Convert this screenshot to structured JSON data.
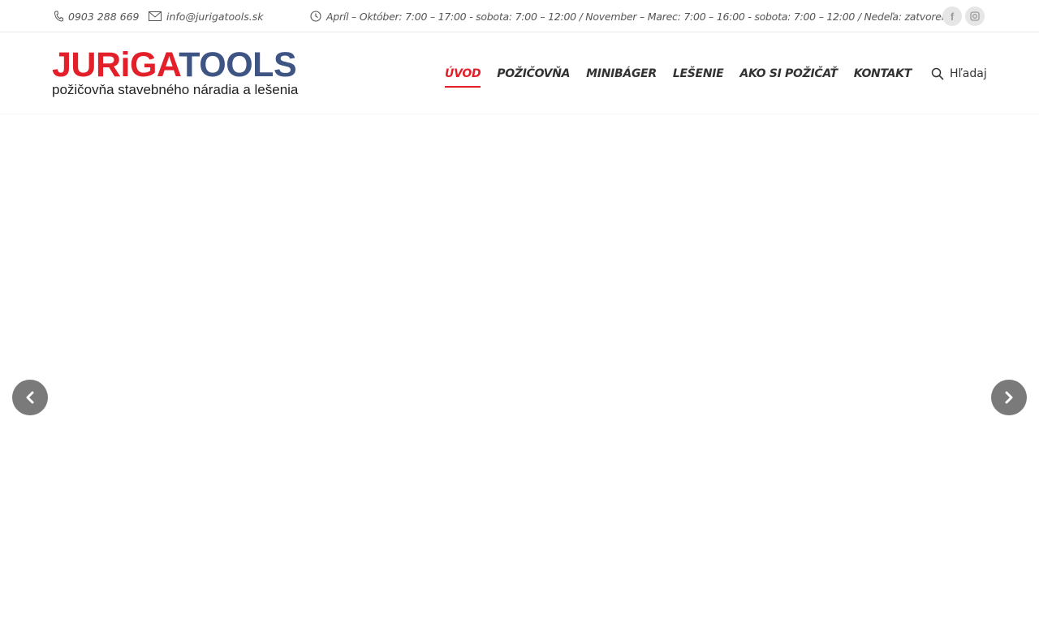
{
  "topbar": {
    "phone": "0903 288 669",
    "email": "info@jurigatools.sk",
    "hours": "Apríl – Október: 7:00 – 17:00 - sobota: 7:00 – 12:00 / November – Marec: 7:00 – 16:00 - sobota: 7:00 – 12:00 / Nedeľa: zatvorené",
    "social": [
      {
        "icon": "facebook-icon",
        "glyph": "f"
      },
      {
        "icon": "instagram-icon"
      }
    ]
  },
  "logo": {
    "word_red_1": "JUR",
    "word_red_i": "i",
    "word_red_2": "GA",
    "word_blue": "TOOLS",
    "tagline": "požičovňa stavebného náradia a lešenia"
  },
  "nav": {
    "items": [
      {
        "label": "ÚVOD",
        "active": true
      },
      {
        "label": "POŽIČOVŇA"
      },
      {
        "label": "MINIBÁGER"
      },
      {
        "label": "LEŠENIE"
      },
      {
        "label": "AKO SI POŽIČAŤ"
      },
      {
        "label": "KONTAKT"
      }
    ],
    "search_label": "Hľadaj"
  },
  "slider": {
    "prev_icon": "chevron-left-icon",
    "next_icon": "chevron-right-icon"
  },
  "colors": {
    "accent_red": "#e3202a",
    "logo_blue": "#3e5584",
    "arrow_bg": "#7a7a7a"
  }
}
